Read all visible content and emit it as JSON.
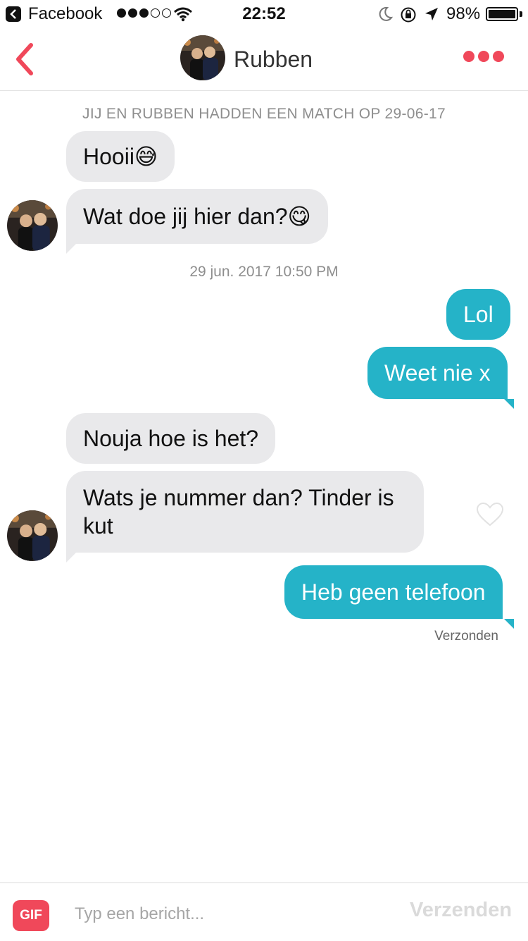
{
  "status_bar": {
    "back_app": "Facebook",
    "time": "22:52",
    "battery_percent": "98%"
  },
  "header": {
    "contact_name": "Rubben"
  },
  "chat": {
    "match_note": "JIJ EN RUBBEN HADDEN EEN MATCH OP 29-06-17",
    "timestamp": "29 jun. 2017 10:50 PM",
    "messages": [
      {
        "dir": "in",
        "text": "Hooii😅"
      },
      {
        "dir": "in",
        "text": "Wat doe jij hier dan?😋"
      },
      {
        "dir": "out",
        "text": "Lol"
      },
      {
        "dir": "out",
        "text": "Weet nie x"
      },
      {
        "dir": "in",
        "text": "Nouja hoe is het?"
      },
      {
        "dir": "in",
        "text": "Wats je nummer dan? Tinder is kut"
      },
      {
        "dir": "out",
        "text": "Heb geen telefoon"
      }
    ],
    "delivery_status": "Verzonden"
  },
  "input_bar": {
    "gif_label": "GIF",
    "placeholder": "Typ een bericht...",
    "send_label": "Verzenden"
  },
  "colors": {
    "accent": "#f0485a",
    "outgoing_bubble": "#25b3c8",
    "incoming_bubble": "#e9e9eb"
  }
}
